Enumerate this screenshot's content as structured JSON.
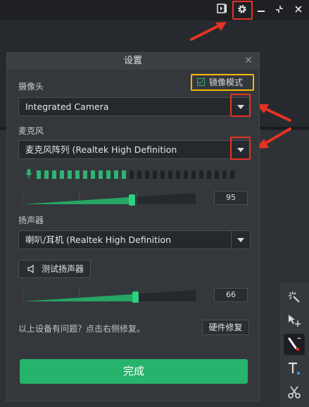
{
  "dialog": {
    "title": "设置",
    "close_icon": "close-icon",
    "camera": {
      "label": "摄像头",
      "mirror_label": "镜像模式",
      "mirror_checked": true,
      "selected": "Integrated Camera"
    },
    "microphone": {
      "label": "麦克风",
      "selected": "麦克风阵列 (Realtek High Definition",
      "meter_active_bars": 12,
      "meter_total_bars": 26,
      "volume": "95",
      "volume_fraction": 0.95
    },
    "speaker": {
      "label": "扬声器",
      "selected": "喇叭/耳机 (Realtek High Definition",
      "test_button_label": "测试扬声器",
      "volume": "66",
      "volume_fraction": 0.66
    },
    "hint": "以上设备有问题？点击右侧修复。",
    "repair_button_label": "硬件修复",
    "done_button_label": "完成"
  },
  "colors": {
    "accent_green": "#26b36b",
    "highlight_yellow": "#f5b800",
    "annotation_red": "#e53224"
  },
  "topbar_icons": [
    "record-icon",
    "gear-icon",
    "minimize-icon",
    "collapse-icon",
    "close-icon"
  ],
  "tool_icons": [
    "effects-icon",
    "select-move-icon",
    "pen-icon",
    "text-icon",
    "scissors-icon"
  ]
}
